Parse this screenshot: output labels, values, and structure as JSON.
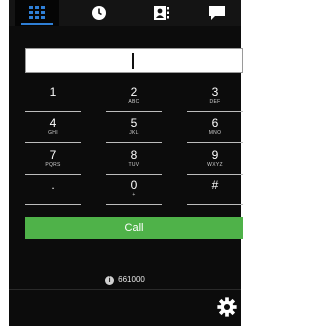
{
  "tabs": [
    {
      "icon": "dialpad-icon",
      "active": true
    },
    {
      "icon": "clock-icon",
      "active": false
    },
    {
      "icon": "contacts-icon",
      "active": false
    },
    {
      "icon": "chat-icon",
      "active": false
    }
  ],
  "dialer": {
    "number_value": ""
  },
  "keypad": [
    {
      "digit": "1",
      "letters": ""
    },
    {
      "digit": "2",
      "letters": "ABC"
    },
    {
      "digit": "3",
      "letters": "DEF"
    },
    {
      "digit": "4",
      "letters": "GHI"
    },
    {
      "digit": "5",
      "letters": "JKL"
    },
    {
      "digit": "6",
      "letters": "MNO"
    },
    {
      "digit": "7",
      "letters": "PQRS"
    },
    {
      "digit": "8",
      "letters": "TUV"
    },
    {
      "digit": "9",
      "letters": "WXYZ"
    },
    {
      "digit": ".",
      "letters": ""
    },
    {
      "digit": "0",
      "letters": "+"
    },
    {
      "digit": "#",
      "letters": ""
    }
  ],
  "call_button": {
    "label": "Call"
  },
  "account": {
    "icon": "info-icon",
    "number": "661000"
  },
  "settings": {
    "icon": "gear-icon"
  },
  "colors": {
    "accent": "#2f7fd6",
    "call": "#4fb249",
    "background": "#0c0c0c"
  }
}
